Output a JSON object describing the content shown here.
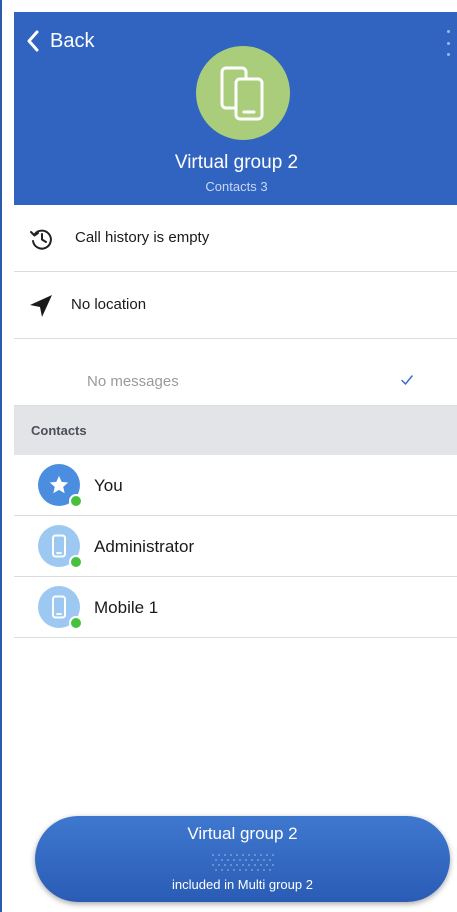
{
  "header": {
    "back_label": "Back",
    "title": "Virtual group 2",
    "subtitle": "Contacts 3",
    "color": "#3064c0",
    "avatar_color": "#a9cd7a"
  },
  "info": {
    "call_history": "Call history is empty",
    "location": "No location",
    "messages": "No messages"
  },
  "contacts": {
    "section_label": "Contacts",
    "items": [
      {
        "name": "You",
        "icon": "star-icon",
        "status": "online"
      },
      {
        "name": "Administrator",
        "icon": "mobile-phone-icon",
        "status": "online"
      },
      {
        "name": "Mobile 1",
        "icon": "mobile-phone-icon",
        "status": "online"
      }
    ]
  },
  "floating_bar": {
    "title": "Virtual group 2",
    "subtitle": "included in Multi group 2"
  },
  "colors": {
    "status_online": "#47c13d",
    "section_bg": "#e2e4e8"
  }
}
